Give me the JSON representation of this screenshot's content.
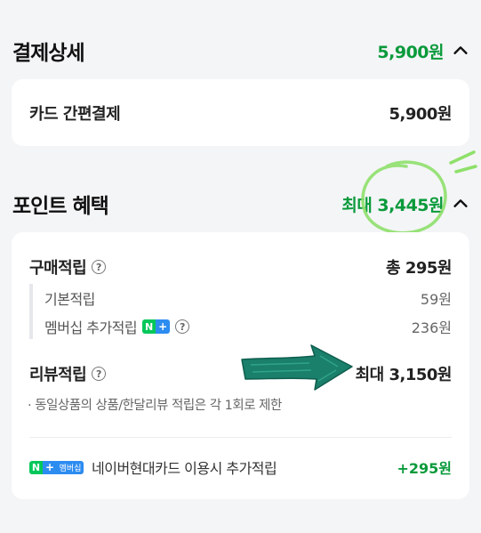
{
  "payment": {
    "title": "결제상세",
    "total": "5,900원",
    "method_label": "카드 간편결제",
    "method_amount": "5,900원"
  },
  "points": {
    "title": "포인트 혜택",
    "max_total": "최대 3,445원",
    "purchase": {
      "label": "구매적립",
      "amount": "총 295원",
      "items": [
        {
          "label": "기본적립",
          "amount": "59원"
        },
        {
          "label": "멤버십 추가적립",
          "amount": "236원"
        }
      ]
    },
    "review": {
      "label": "리뷰적립",
      "amount": "최대 3,150원",
      "note": "· 동일상품의 상품/한달리뷰 적립은 각 1회로 제한"
    },
    "card_bonus": {
      "badge_n": "N",
      "badge_plus": "+",
      "badge_text": "멤버십",
      "label": "네이버현대카드 이용시 추가적립",
      "amount": "+295원"
    }
  },
  "colors": {
    "accent_green": "#0a9a3b",
    "circle_highlight": "#8ee06a",
    "arrow_fill": "#1a7f6b"
  },
  "icons": [
    "chevron-up-icon",
    "help-circle-icon",
    "naver-membership-badge-icon",
    "arrow-annotation-icon",
    "circle-annotation-icon"
  ]
}
